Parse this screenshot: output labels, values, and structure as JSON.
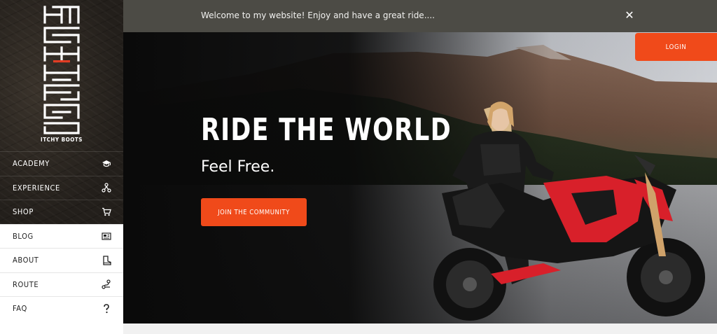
{
  "banner": {
    "message": "Welcome to my website! Enjoy and have a great ride....",
    "close_glyph": "✕"
  },
  "sidebar": {
    "brand": "ITCHY BOOTS",
    "items": [
      {
        "label": "ACADEMY",
        "icon": "graduation-cap-icon",
        "theme": "dark"
      },
      {
        "label": "EXPERIENCE",
        "icon": "rider-icon",
        "theme": "dark"
      },
      {
        "label": "SHOP",
        "icon": "cart-icon",
        "theme": "dark"
      },
      {
        "label": "BLOG",
        "icon": "newspaper-icon",
        "theme": "light"
      },
      {
        "label": "ABOUT",
        "icon": "boot-icon",
        "theme": "light"
      },
      {
        "label": "ROUTE",
        "icon": "route-icon",
        "theme": "light"
      },
      {
        "label": "FAQ",
        "icon": "question-icon",
        "theme": "light"
      }
    ]
  },
  "hero": {
    "title": "RIDE THE WORLD",
    "subtitle": "Feel Free.",
    "cta_label": "JOIN THE COMMUNITY"
  },
  "header": {
    "login_label": "LOGIN"
  },
  "colors": {
    "accent": "#f04a1a",
    "banner_bg": "#4c4b45",
    "sidebar_dark": "#2a2520",
    "bike_red": "#d8202a"
  }
}
